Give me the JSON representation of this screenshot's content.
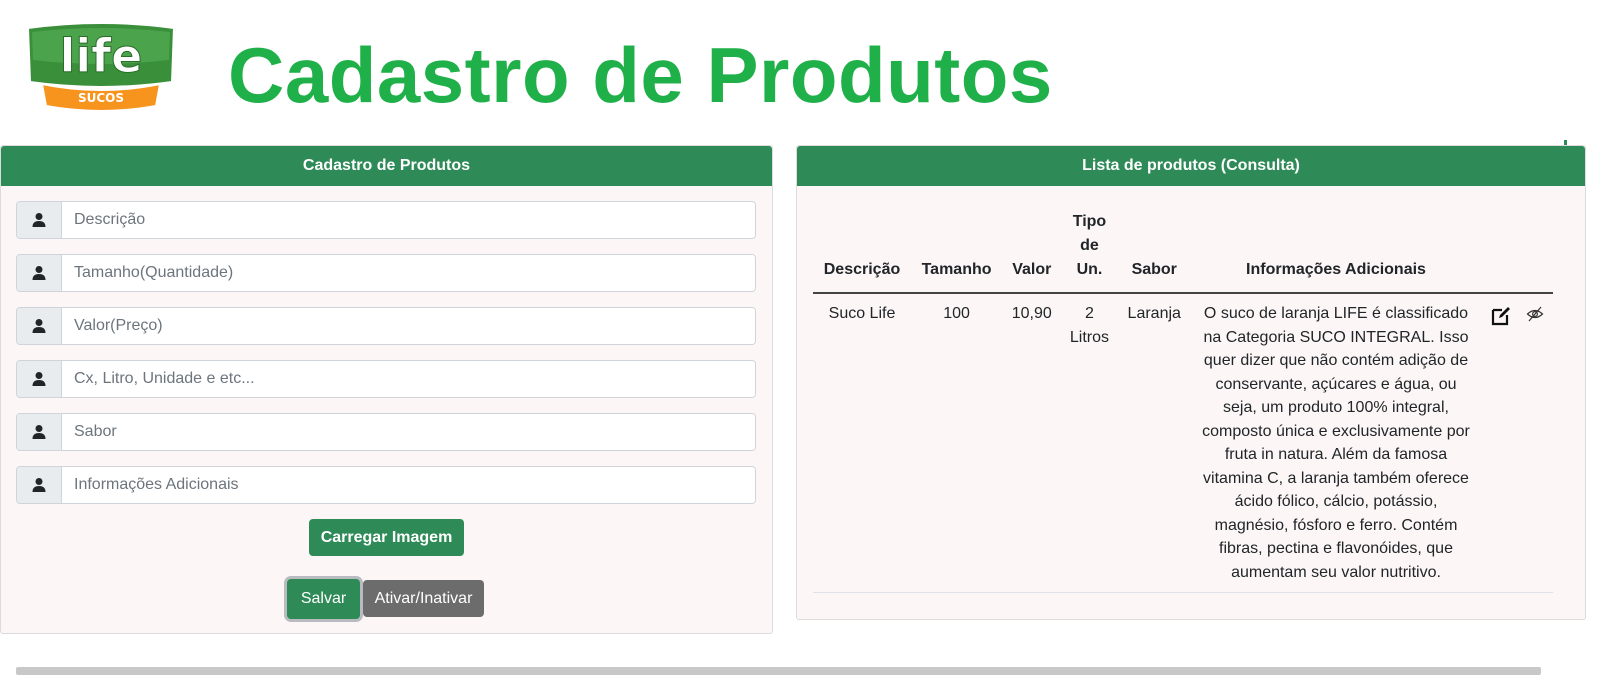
{
  "header": {
    "logo_text": "life",
    "logo_sub": "SUCOS",
    "title": "Cadastro de Produtos"
  },
  "form": {
    "title": "Cadastro de Produtos",
    "fields": [
      {
        "placeholder": "Descrição",
        "icon": "user-icon"
      },
      {
        "placeholder": "Tamanho(Quantidade)",
        "icon": "user-icon"
      },
      {
        "placeholder": "Valor(Preço)",
        "icon": "user-icon"
      },
      {
        "placeholder": "Cx, Litro, Unidade e etc...",
        "icon": "user-icon"
      },
      {
        "placeholder": "Sabor",
        "icon": "user-icon"
      },
      {
        "placeholder": "Informações Adicionais",
        "icon": "user-icon"
      }
    ],
    "load_image_label": "Carregar Imagem",
    "save_label": "Salvar",
    "toggle_label": "Ativar/Inativar"
  },
  "list": {
    "title": "Lista de produtos (Consulta)",
    "columns": [
      "Descrição",
      "Tamanho",
      "Valor",
      "Tipo de Un.",
      "Sabor",
      "Informações Adicionais"
    ],
    "rows": [
      {
        "descricao": "Suco Life",
        "tamanho": "100",
        "valor": "10,90",
        "tipo": "2 Litros",
        "sabor": "Laranja",
        "info": "O suco de laranja LIFE é classificado na Categoria SUCO INTEGRAL. Isso quer dizer que não contém adição de conservante, açúcares e água, ou seja, um produto 100% integral, composto única e exclusivamente por fruta in natura. Além da famosa vitamina C, a laranja também oferece ácido fólico, cálcio, potássio, magnésio, fósforo e ferro. Contém fibras, pectina e flavonóides, que aumentam seu valor nutritivo."
      }
    ]
  },
  "colors": {
    "brand_green": "#20b04a",
    "header_green": "#2e8b57",
    "gray_button": "#6c6c6c"
  }
}
